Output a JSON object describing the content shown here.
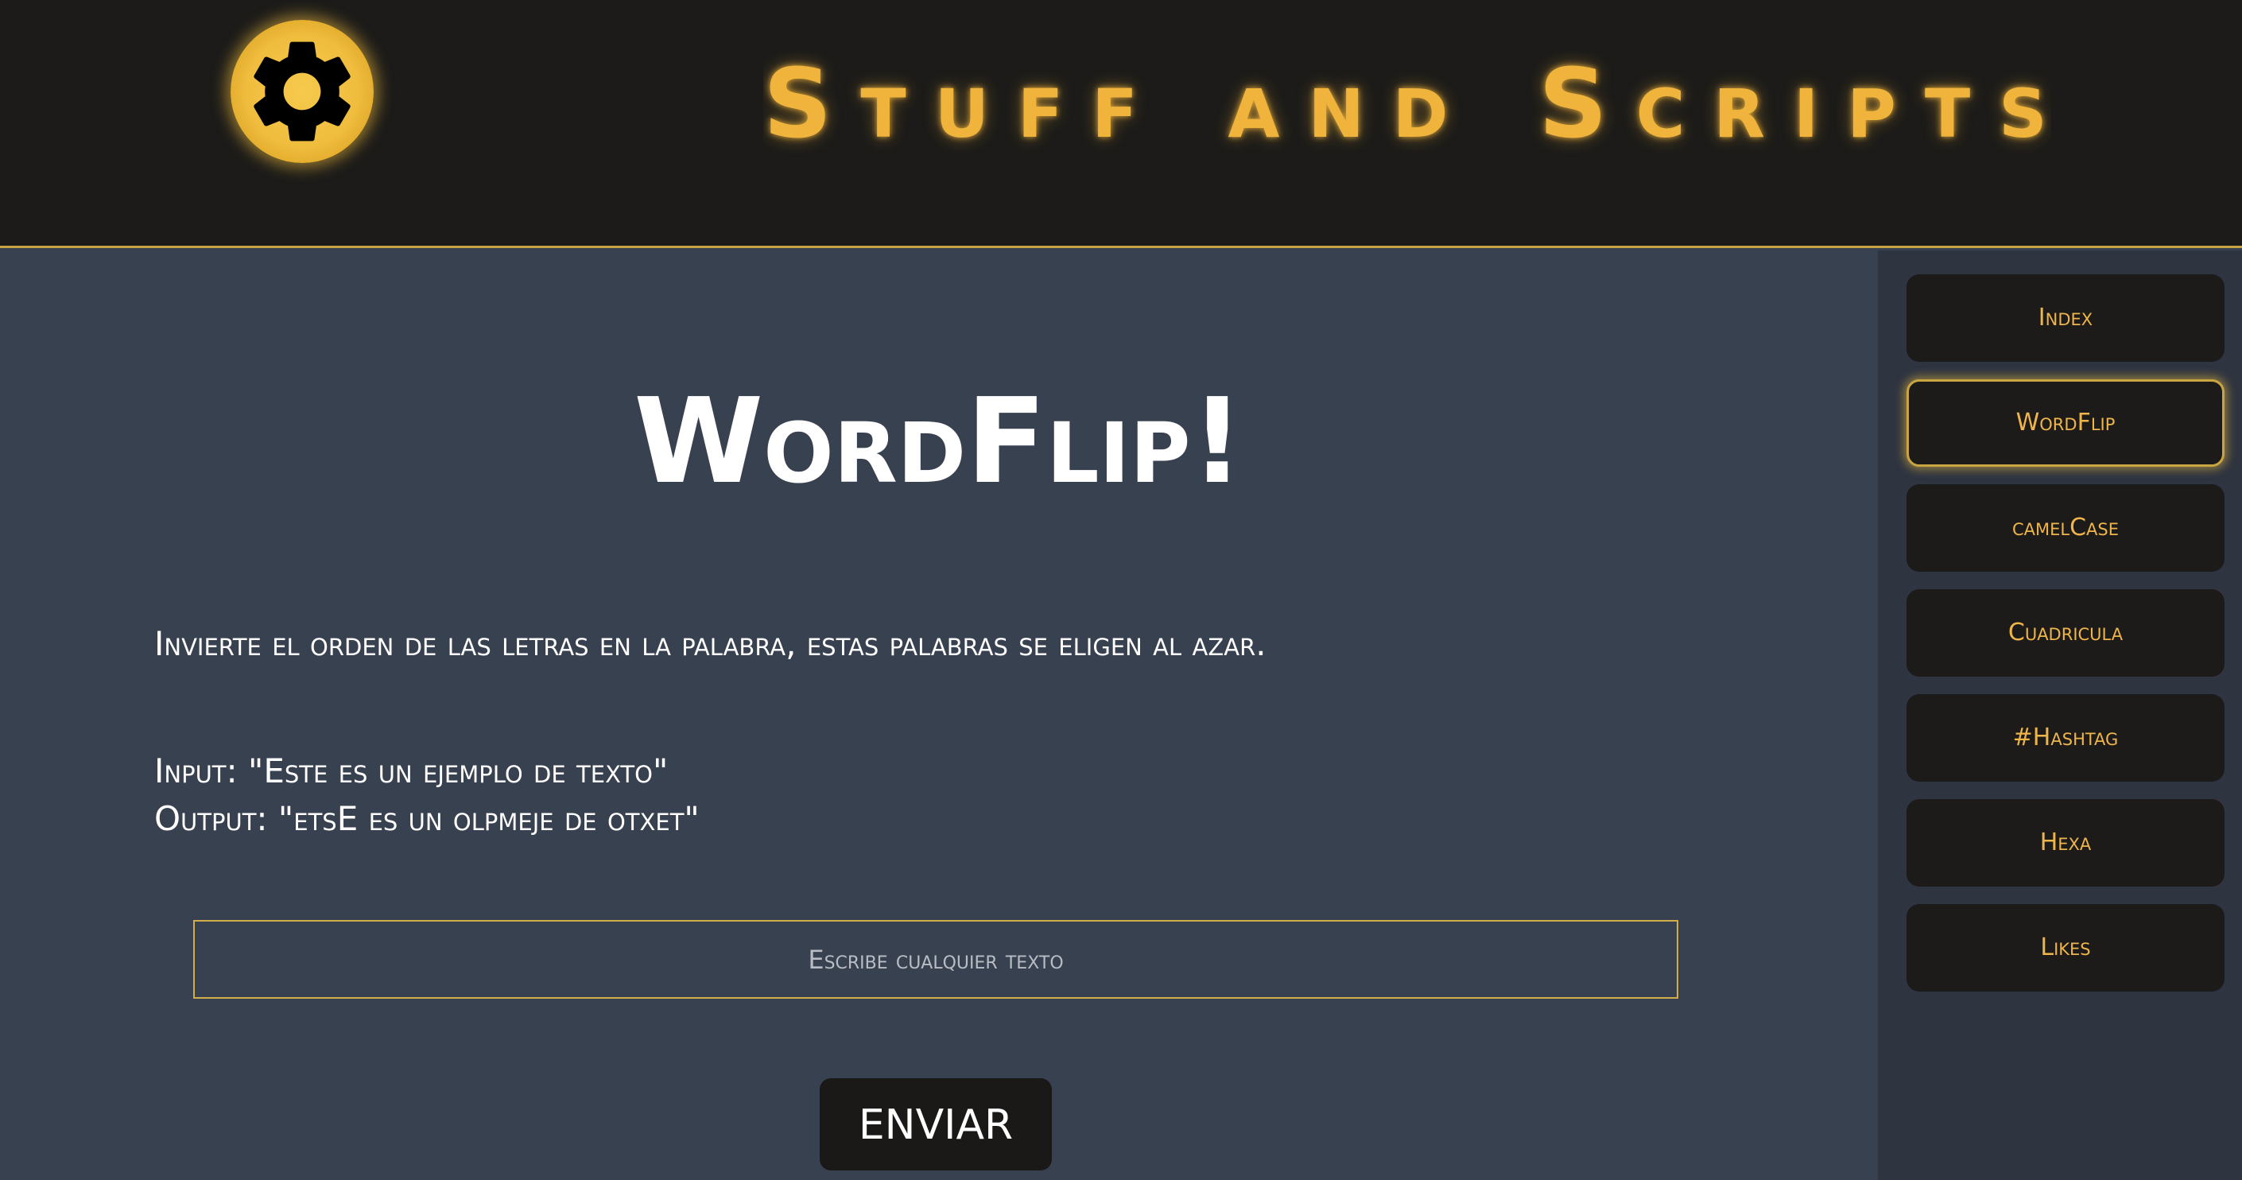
{
  "header": {
    "title": "Stuff and Scripts",
    "logo_icon": "gear-icon"
  },
  "main": {
    "heading": "WordFlip!",
    "description": "Invierte el orden de las letras en la palabra, estas palabras se eligen al azar.",
    "example_input": "Input: \"Este es un ejemplo de texto\"",
    "example_output": "Output: \"etsE es un olpmeje de otxet\"",
    "text_input": {
      "placeholder": "Escribe cualquier texto",
      "value": ""
    },
    "submit_label": "ENVIAR"
  },
  "sidebar": {
    "active_index": 1,
    "items": [
      {
        "label": "Index"
      },
      {
        "label": "WordFlip"
      },
      {
        "label": "camelCase"
      },
      {
        "label": "Cuadricula"
      },
      {
        "label": "#Hashtag"
      },
      {
        "label": "Hexa"
      },
      {
        "label": "Likes"
      }
    ]
  },
  "colors": {
    "header_bg": "#1c1b19",
    "main_bg": "#384150",
    "sidebar_bg": "#2e3440",
    "accent": "#f0b33b",
    "text": "#ffffff"
  }
}
